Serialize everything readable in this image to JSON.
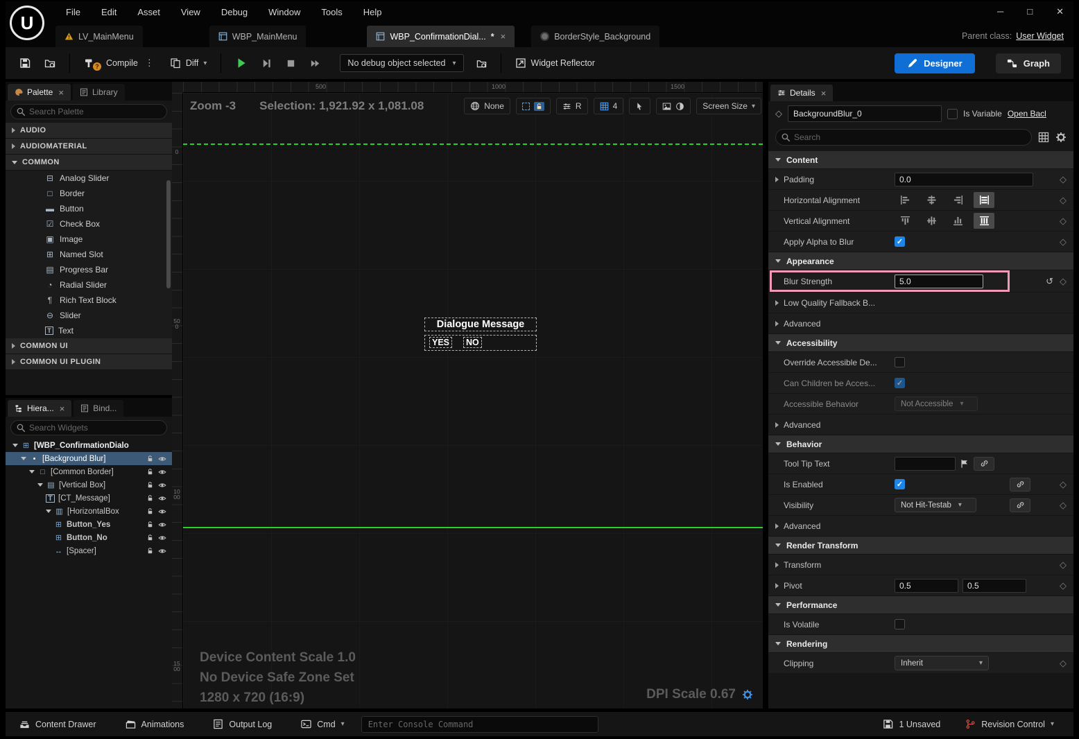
{
  "icons": {
    "minimize": "─",
    "maximize": "□",
    "close": "✕",
    "tab_close": "×",
    "dirty": "*",
    "kebab": "⋮",
    "caret": "▾",
    "diamond": "◇",
    "reset": "↺",
    "logo": "U"
  },
  "menubar": {
    "items": [
      "File",
      "Edit",
      "Asset",
      "View",
      "Debug",
      "Window",
      "Tools",
      "Help"
    ]
  },
  "tabbar": {
    "tabs": [
      {
        "label": "LV_MainMenu"
      },
      {
        "label": "WBP_MainMenu"
      },
      {
        "label": "WBP_ConfirmationDial..."
      },
      {
        "label": "BorderStyle_Background"
      }
    ],
    "parent_class_label": "Parent class:",
    "parent_class_value": "User Widget"
  },
  "toolbar": {
    "compile_label": "Compile",
    "diff_label": "Diff",
    "debug_object": "No debug object selected",
    "widget_reflector": "Widget Reflector",
    "designer": "Designer",
    "graph": "Graph"
  },
  "palette": {
    "tab_palette": "Palette",
    "tab_library": "Library",
    "search_placeholder": "Search Palette",
    "groups": [
      {
        "label": "AUDIO"
      },
      {
        "label": "AUDIOMATERIAL"
      },
      {
        "label": "COMMON"
      },
      {
        "label": "COMMON UI"
      },
      {
        "label": "COMMON UI PLUGIN"
      }
    ],
    "common_items": [
      {
        "label": "Analog Slider",
        "glyph": "⊟"
      },
      {
        "label": "Border",
        "glyph": "□"
      },
      {
        "label": "Button",
        "glyph": "▬"
      },
      {
        "label": "Check Box",
        "glyph": "☑"
      },
      {
        "label": "Image",
        "glyph": "▣"
      },
      {
        "label": "Named Slot",
        "glyph": "⊞"
      },
      {
        "label": "Progress Bar",
        "glyph": "▤"
      },
      {
        "label": "Radial Slider",
        "glyph": "◔"
      },
      {
        "label": "Rich Text Block",
        "glyph": "¶"
      },
      {
        "label": "Slider",
        "glyph": "⊖"
      },
      {
        "label": "Text",
        "glyph": "T"
      }
    ]
  },
  "hierarchy": {
    "tab_hierarchy": "Hiera...",
    "tab_bind": "Bind...",
    "search_placeholder": "Search Widgets",
    "items": [
      {
        "label": "[WBP_ConfirmationDialo",
        "glyph": "⊞"
      },
      {
        "label": "[Background Blur]",
        "glyph": "•"
      },
      {
        "label": "[Common Border]",
        "glyph": "□"
      },
      {
        "label": "[Vertical Box]",
        "glyph": "▤"
      },
      {
        "label": "[CT_Message]",
        "glyph": "T"
      },
      {
        "label": "[HorizontalBox",
        "glyph": "▥"
      },
      {
        "label": "Button_Yes",
        "glyph": "⊞"
      },
      {
        "label": "Button_No",
        "glyph": "⊞"
      },
      {
        "label": "[Spacer]",
        "glyph": "↔"
      }
    ]
  },
  "canvas": {
    "zoom": "Zoom -3",
    "selection": "Selection: 1,921.92 x 1,081.08",
    "none": "None",
    "r": "R",
    "grid_size": "4",
    "screen_size": "Screen Size",
    "ruler_top": [
      "500",
      "1000",
      "1500"
    ],
    "ruler_left": [
      "0",
      "500",
      "1000",
      "1500"
    ],
    "widget": {
      "message": "Dialogue Message",
      "yes": "YES",
      "no": "NO"
    },
    "footer": {
      "content_scale": "Device Content Scale 1.0",
      "safe_zone": "No Device Safe Zone Set",
      "resolution": "1280 x 720 (16:9)",
      "dpi": "DPI Scale 0.67"
    }
  },
  "details": {
    "tab": "Details",
    "widget_name": "BackgroundBlur_0",
    "is_variable": "Is Variable",
    "open_link": "Open Bacl",
    "search_placeholder": "Search",
    "sections": {
      "content": {
        "title": "Content",
        "padding_label": "Padding",
        "padding_value": "0.0",
        "halign_label": "Horizontal Alignment",
        "valign_label": "Vertical Alignment",
        "apply_alpha_label": "Apply Alpha to Blur"
      },
      "appearance": {
        "title": "Appearance",
        "blur_strength_label": "Blur Strength",
        "blur_strength_value": "5.0",
        "low_quality_label": "Low Quality Fallback B...",
        "advanced_label": "Advanced"
      },
      "accessibility": {
        "title": "Accessibility",
        "override_label": "Override Accessible De...",
        "can_children_label": "Can Children be Acces...",
        "behavior_label": "Accessible Behavior",
        "behavior_value": "Not Accessible",
        "advanced_label": "Advanced"
      },
      "behavior": {
        "title": "Behavior",
        "tooltip_label": "Tool Tip Text",
        "is_enabled_label": "Is Enabled",
        "visibility_label": "Visibility",
        "visibility_value": "Not Hit-Testab",
        "advanced_label": "Advanced"
      },
      "render_transform": {
        "title": "Render Transform",
        "transform_label": "Transform",
        "pivot_label": "Pivot",
        "pivot_x": "0.5",
        "pivot_y": "0.5"
      },
      "performance": {
        "title": "Performance",
        "is_volatile_label": "Is Volatile"
      },
      "rendering": {
        "title": "Rendering",
        "clipping_label": "Clipping",
        "clipping_value": "Inherit"
      }
    }
  },
  "statusbar": {
    "content_drawer": "Content Drawer",
    "animations": "Animations",
    "output_log": "Output Log",
    "cmd": "Cmd",
    "console_placeholder": "Enter Console Command",
    "unsaved": "1 Unsaved",
    "revision_control": "Revision Control"
  }
}
